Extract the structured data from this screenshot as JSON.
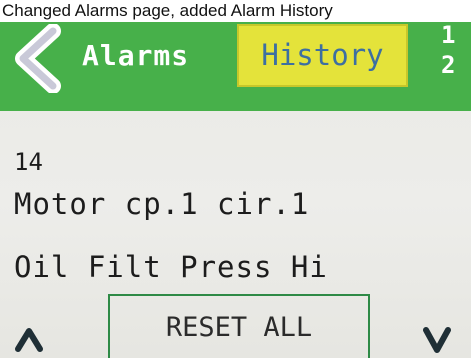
{
  "caption": "Changed Alarms page, added Alarm History",
  "header": {
    "back_icon": "chevron-left-icon",
    "title": "Alarms",
    "history_tab": "History",
    "page_current": "1",
    "page_total": "2"
  },
  "alarm": {
    "number": "14",
    "source": "Motor cp.1 cir.1",
    "message": "Oil Filt Press Hi"
  },
  "footer": {
    "up_icon": "caret-up-icon",
    "reset_label": "RESET ALL",
    "down_icon": "caret-down-icon"
  },
  "colors": {
    "header_green": "#47b04a",
    "history_yellow": "#e4e33a",
    "history_text": "#3d6fa1",
    "screen_bg": "#ebebe7",
    "reset_border": "#2e8a46"
  }
}
